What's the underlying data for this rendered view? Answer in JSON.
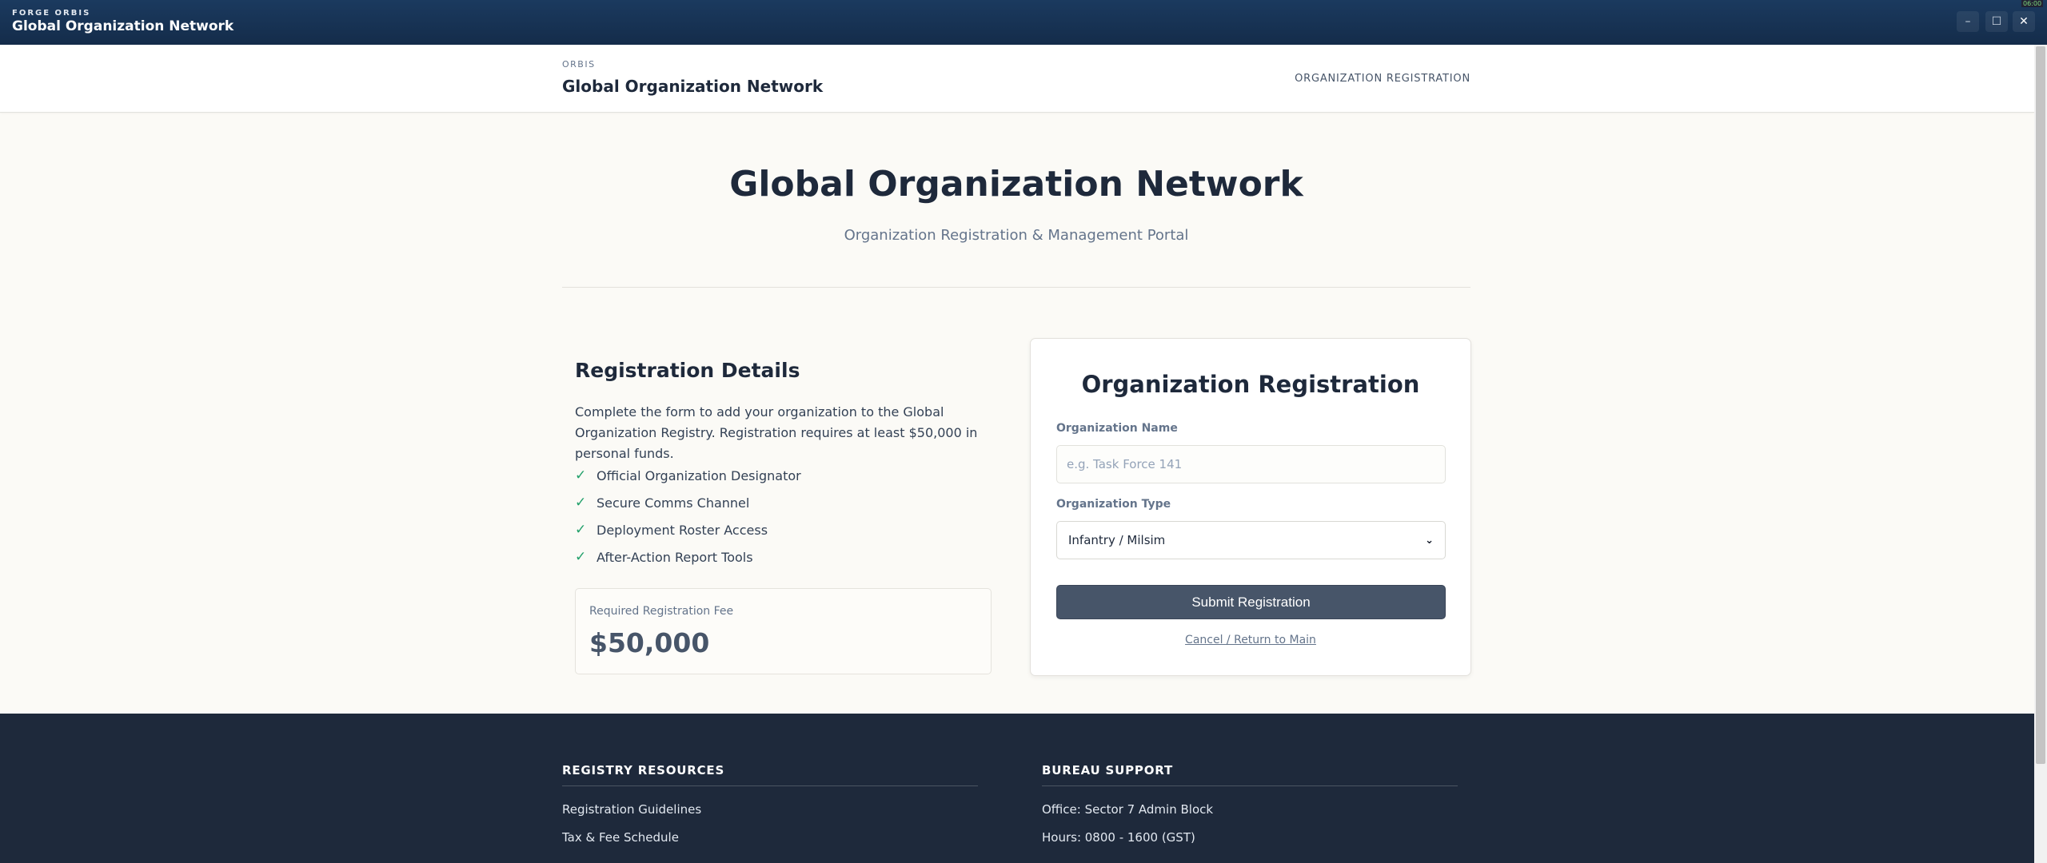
{
  "window": {
    "kicker": "FORGE ORBIS",
    "title": "Global Organization Network",
    "minimize_glyph": "–",
    "maximize_glyph": "☐",
    "close_glyph": "✕",
    "corner_tag": "06:00"
  },
  "header": {
    "kicker": "ORBIS",
    "name": "Global Organization Network",
    "nav_link": "ORGANIZATION REGISTRATION"
  },
  "hero": {
    "title": "Global Organization Network",
    "subtitle": "Organization Registration & Management Portal"
  },
  "details": {
    "title": "Registration Details",
    "description": "Complete the form to add your organization to the Global Organization Registry. Registration requires at least $50,000 in personal funds.",
    "features": [
      "Official Organization Designator",
      "Secure Comms Channel",
      "Deployment Roster Access",
      "After-Action Report Tools"
    ],
    "fee_label": "Required Registration Fee",
    "fee_value": "$50,000"
  },
  "form": {
    "title": "Organization Registration",
    "name_label": "Organization Name",
    "name_placeholder": "e.g. Task Force 141",
    "name_value": "",
    "type_label": "Organization Type",
    "type_selected": "Infantry / Milsim",
    "submit_label": "Submit Registration",
    "cancel_label": "Cancel / Return to Main"
  },
  "footer": {
    "left_heading": "REGISTRY RESOURCES",
    "left_items": [
      "Registration Guidelines",
      "Tax & Fee Schedule"
    ],
    "right_heading": "BUREAU SUPPORT",
    "right_items": [
      "Office: Sector 7 Admin Block",
      "Hours: 0800 - 1600 (GST)"
    ]
  },
  "icons": {
    "feature_check": "check-icon",
    "select_chevron": "chevron-down-icon"
  },
  "colors": {
    "titlebar": "#1b3a5f",
    "page_bg": "#fbfaf6",
    "check": "#22a06b",
    "submit_bg": "#475569",
    "footer_bg": "#1e293b"
  }
}
